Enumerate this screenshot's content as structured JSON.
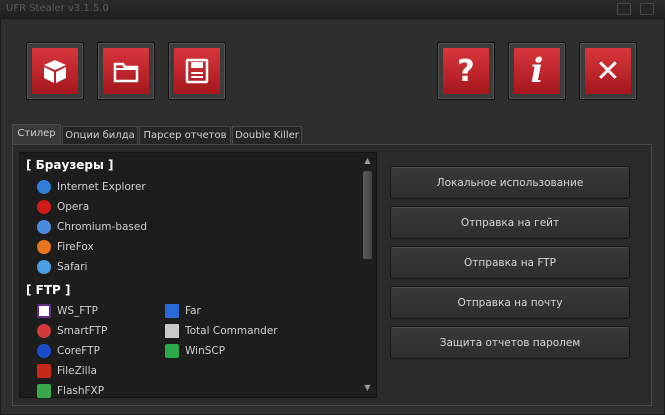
{
  "window": {
    "title": "UFR Stealer v3.1.5.0"
  },
  "toolbar": {
    "left": [
      {
        "name": "cube-icon"
      },
      {
        "name": "folder-icon"
      },
      {
        "name": "save-icon"
      }
    ],
    "right": [
      {
        "name": "help-icon",
        "glyph": "?"
      },
      {
        "name": "info-icon",
        "glyph": "i"
      },
      {
        "name": "close-icon",
        "glyph": "✕"
      }
    ]
  },
  "tabs": [
    {
      "label": "Стилер"
    },
    {
      "label": "Опции билда"
    },
    {
      "label": "Парсер отчетов"
    },
    {
      "label": "Double Killer"
    }
  ],
  "list": {
    "browsers_header": "[ Браузеры ]",
    "browsers": [
      {
        "label": "Internet Explorer",
        "color": "#2f7fd9"
      },
      {
        "label": "Opera",
        "color": "#d21a1a"
      },
      {
        "label": "Chromium-based",
        "color": "#4a8de0"
      },
      {
        "label": "FireFox",
        "color": "#e8741c"
      },
      {
        "label": "Safari",
        "color": "#4aa0e6"
      }
    ],
    "ftp_header": "[ FTP ]",
    "ftp_col1": [
      {
        "label": "WS_FTP",
        "color": "#6a2a8a"
      },
      {
        "label": "SmartFTP",
        "color": "#d23a3a"
      },
      {
        "label": "CoreFTP",
        "color": "#1a4ec8"
      },
      {
        "label": "FileZilla",
        "color": "#c8281c"
      },
      {
        "label": "FlashFXP",
        "color": "#3aa84a"
      }
    ],
    "ftp_col2": [
      {
        "label": "Far",
        "color": "#2a6ad8"
      },
      {
        "label": "Total Commander",
        "color": "#c8c8c8"
      },
      {
        "label": "WinSCP",
        "color": "#2aa84a"
      }
    ]
  },
  "actions": [
    {
      "label": "Локальное использование"
    },
    {
      "label": "Отправка на гейт"
    },
    {
      "label": "Отправка на FTP"
    },
    {
      "label": "Отправка на почту"
    },
    {
      "label": "Защита отчетов паролем"
    }
  ]
}
